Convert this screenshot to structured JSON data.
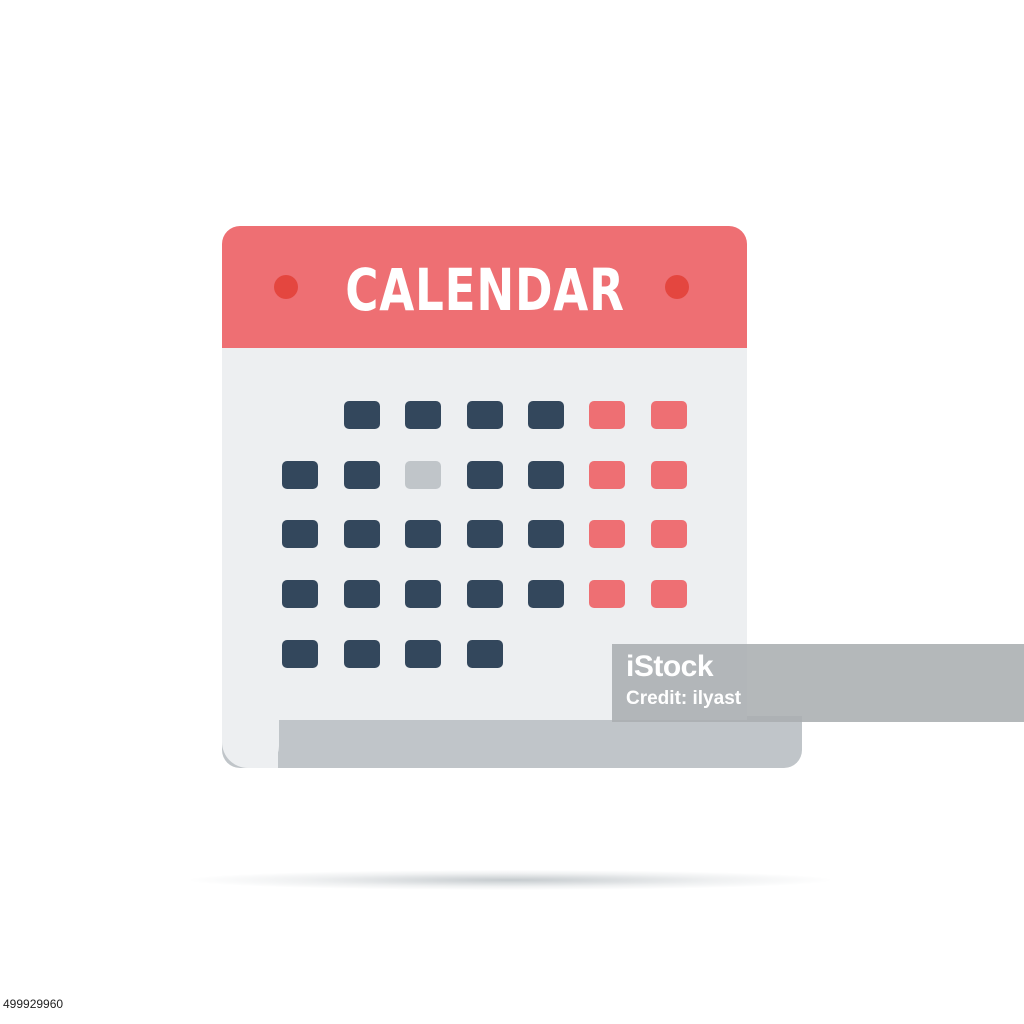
{
  "calendar": {
    "title": "CALENDAR",
    "colors": {
      "header": "#ee6f73",
      "binding_holes": "#e4463f",
      "page": "#edeff1",
      "weekday": "#33475c",
      "weekend": "#ee6f73",
      "today": "#c0c5c9",
      "curl": "#c0c5c9"
    },
    "weeks": [
      [
        "empty",
        "weekday",
        "weekday",
        "weekday",
        "weekday",
        "weekend",
        "weekend"
      ],
      [
        "weekday",
        "weekday",
        "today",
        "weekday",
        "weekday",
        "weekend",
        "weekend"
      ],
      [
        "weekday",
        "weekday",
        "weekday",
        "weekday",
        "weekday",
        "weekend",
        "weekend"
      ],
      [
        "weekday",
        "weekday",
        "weekday",
        "weekday",
        "weekday",
        "weekend",
        "weekend"
      ],
      [
        "weekday",
        "weekday",
        "weekday",
        "weekday",
        "empty",
        "empty",
        "empty"
      ]
    ]
  },
  "watermark": {
    "logo": "iStock",
    "credit": "Credit: ilyast"
  },
  "stock_id": "499929960"
}
